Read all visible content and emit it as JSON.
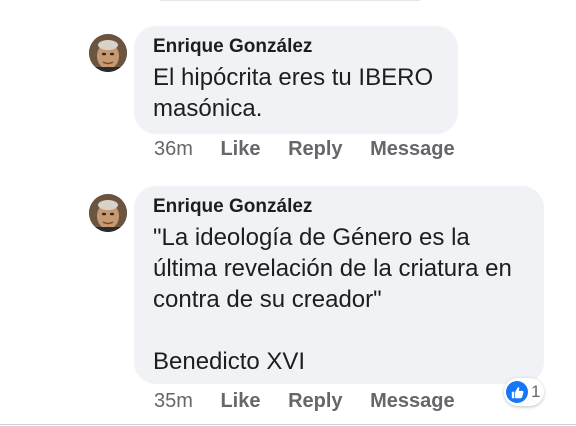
{
  "comments": [
    {
      "author": "Enrique González",
      "text": "El hipócrita eres tu IBERO\nmasónica.",
      "time": "36m",
      "actions": [
        "Like",
        "Reply",
        "Message"
      ]
    },
    {
      "author": "Enrique González",
      "text": "\"La ideología de Género es la\núltima revelación de la criatura en\ncontra de su creador\"\n\nBenedicto XVI",
      "time": "35m",
      "actions": [
        "Like",
        "Reply",
        "Message"
      ],
      "reactions": {
        "icon": "like-icon",
        "count": "1"
      }
    }
  ],
  "colors": {
    "bubble": "#f0f2f5",
    "muted_text": "#65676b",
    "like_blue": "#1877f2"
  }
}
